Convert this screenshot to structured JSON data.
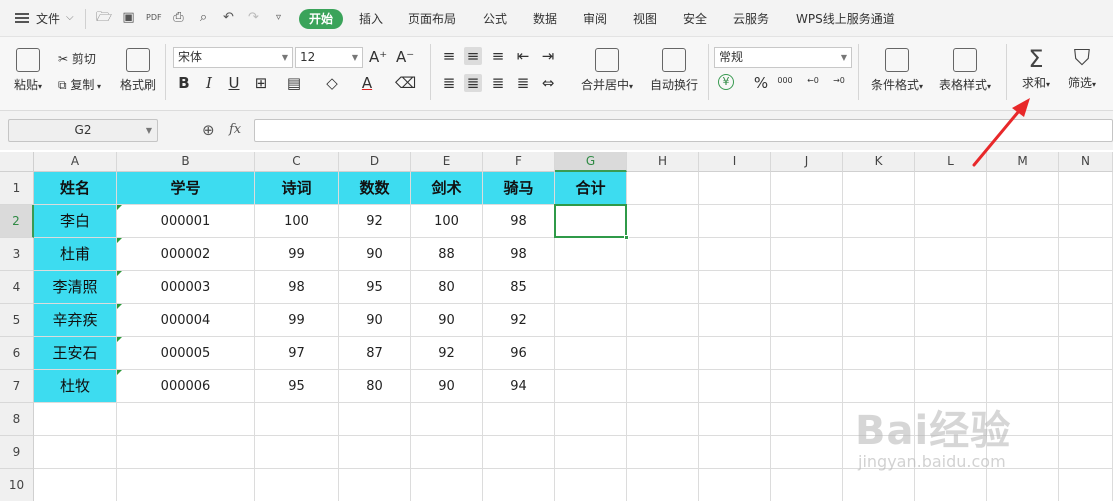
{
  "menu": {
    "file_label": "文件",
    "tabs": [
      "开始",
      "插入",
      "页面布局",
      "公式",
      "数据",
      "审阅",
      "视图",
      "安全",
      "云服务",
      "WPS线上服务通道"
    ]
  },
  "ribbon": {
    "paste": "粘贴",
    "cut": "剪切",
    "copy": "复制",
    "format_painter": "格式刷",
    "font_name": "宋体",
    "font_size": "12",
    "bold": "B",
    "italic": "I",
    "underline": "U",
    "merge_center": "合并居中",
    "wrap_text": "自动换行",
    "number_format": "常规",
    "currency": "¥",
    "percent": "%",
    "thousands": "000",
    "cond_format": "条件格式",
    "table_style": "表格样式",
    "sum": "求和",
    "filter": "筛选"
  },
  "formula_bar": {
    "name_box": "G2",
    "fx": "fx",
    "value": ""
  },
  "sheet": {
    "columns": [
      "A",
      "B",
      "C",
      "D",
      "E",
      "F",
      "G",
      "H",
      "I",
      "J",
      "K",
      "L",
      "M",
      "N"
    ],
    "rows": [
      "1",
      "2",
      "3",
      "4",
      "5",
      "6",
      "7",
      "8",
      "9",
      "10"
    ],
    "headers": [
      "姓名",
      "学号",
      "诗词",
      "数数",
      "剑术",
      "骑马",
      "合计"
    ],
    "data": [
      [
        "李白",
        "000001",
        "100",
        "92",
        "100",
        "98"
      ],
      [
        "杜甫",
        "000002",
        "99",
        "90",
        "88",
        "98"
      ],
      [
        "李清照",
        "000003",
        "98",
        "95",
        "80",
        "85"
      ],
      [
        "辛弃疾",
        "000004",
        "99",
        "90",
        "90",
        "92"
      ],
      [
        "王安石",
        "000005",
        "97",
        "87",
        "92",
        "96"
      ],
      [
        "杜牧",
        "000006",
        "95",
        "80",
        "90",
        "94"
      ]
    ],
    "active_cell": "G2"
  },
  "watermark": {
    "brand": "Bai经验",
    "url": "jingyan.baidu.com"
  },
  "colors": {
    "header_fill": "#3ddcf0",
    "accent_green": "#3aa35a",
    "arrow_red": "#e8282a"
  }
}
